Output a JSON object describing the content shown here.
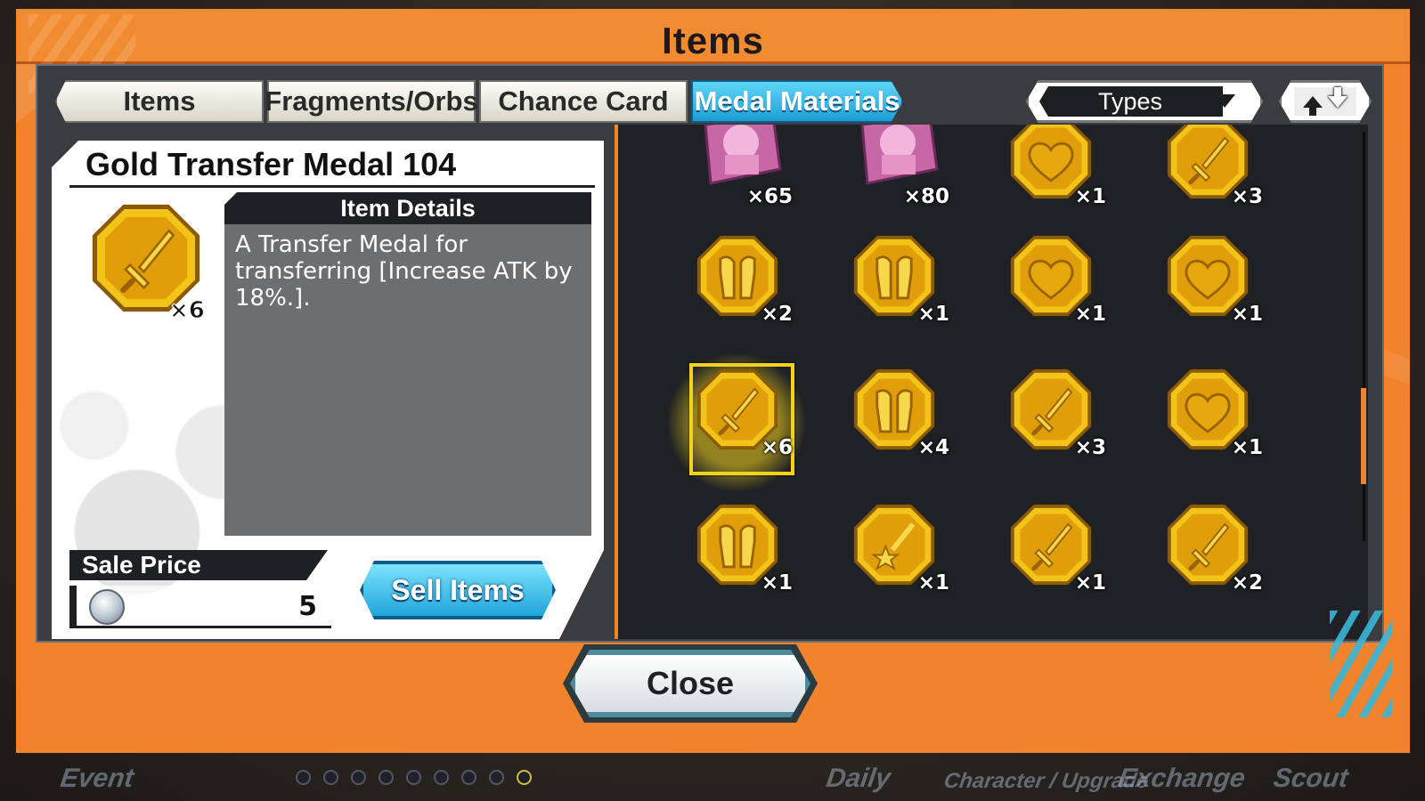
{
  "window": {
    "title": "Items"
  },
  "tabs": [
    {
      "label": "Items",
      "active": false
    },
    {
      "label": "Fragments/Orbs",
      "active": false
    },
    {
      "label": "Chance Card",
      "active": false
    },
    {
      "label": "Medal Materials",
      "active": true
    }
  ],
  "filter": {
    "label": "Types"
  },
  "detail": {
    "name": "Gold Transfer Medal 104",
    "quantity": "×6",
    "details_header": "Item Details",
    "description": "A Transfer Medal for transferring [Increase ATK by 18%.].",
    "sale_price_label": "Sale Price",
    "sale_price_value": "5",
    "sell_button": "Sell Items"
  },
  "grid": [
    {
      "icon": "character-portrait-icon",
      "qty": "×65"
    },
    {
      "icon": "character-portrait-icon",
      "qty": "×80"
    },
    {
      "icon": "heart-medal-icon",
      "qty": "×1"
    },
    {
      "icon": "sword-medal-icon",
      "qty": "×3"
    },
    {
      "icon": "armor-medal-icon",
      "qty": "×2"
    },
    {
      "icon": "armor-medal-icon",
      "qty": "×1"
    },
    {
      "icon": "heart-medal-icon",
      "qty": "×1"
    },
    {
      "icon": "heart-medal-icon",
      "qty": "×1"
    },
    {
      "icon": "sword-medal-icon",
      "qty": "×6",
      "selected": true
    },
    {
      "icon": "armor-medal-icon",
      "qty": "×4"
    },
    {
      "icon": "sword-medal-icon",
      "qty": "×3"
    },
    {
      "icon": "heart-medal-icon",
      "qty": "×1"
    },
    {
      "icon": "armor-medal-icon",
      "qty": "×1"
    },
    {
      "icon": "star-medal-icon",
      "qty": "×1"
    },
    {
      "icon": "sword-medal-icon",
      "qty": "×1"
    },
    {
      "icon": "sword-medal-icon",
      "qty": "×2"
    }
  ],
  "close_button": "Close",
  "bottom_nav": [
    "Event",
    "Daily",
    "Character / Upgrade",
    "Exchange",
    "Scout"
  ],
  "page_dots": {
    "count": 9,
    "active": 8
  },
  "colors": {
    "accent": "#f0832b",
    "tab_active": "#1d9ed4",
    "medal_gold": "#e6b112",
    "selection": "#f2d21c"
  }
}
